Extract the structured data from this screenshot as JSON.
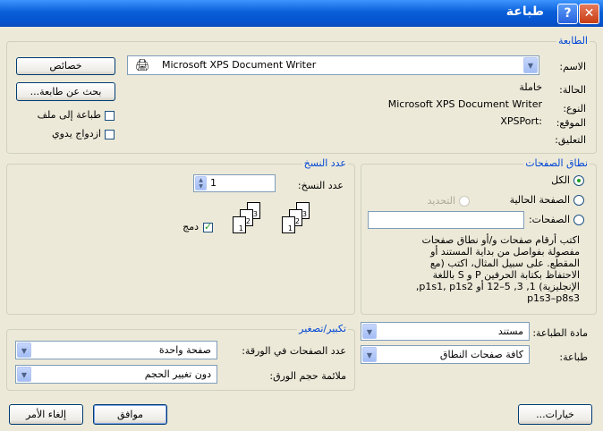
{
  "window": {
    "title": "طباعة",
    "help_icon": "question-mark",
    "close_icon": "x"
  },
  "printer": {
    "group_label": "الطابعة",
    "name_label": "الاسم:",
    "name_value": "Microsoft XPS Document Writer",
    "status_label": "الحالة:",
    "status_value": "خاملة",
    "type_label": "النوع:",
    "type_value": "Microsoft XPS Document Writer",
    "where_label": "الموقع:",
    "where_value": "XPSPort:",
    "comment_label": "التعليق:",
    "comment_value": "",
    "properties_button": "خصائص",
    "find_printer_button": "بحث عن طابعة...",
    "print_to_file_label": "طباعة إلى ملف",
    "print_to_file_checked": false,
    "manual_duplex_label": "ازدواج يدوي",
    "manual_duplex_checked": false
  },
  "page_range": {
    "group_label": "نطاق الصفحات",
    "all_label": "الكل",
    "current_page_label": "الصفحة الحالية",
    "selection_label": "التحديد",
    "pages_label": "الصفحات:",
    "pages_value": "",
    "selected": "all",
    "help_text": [
      "اكتب أرقام صفحات و/أو نطاق صفحات",
      "مفصولة بفواصل من بداية المستند أو",
      "المقطع. على سبيل المثال، اكتب (مع",
      "الاحتفاظ بكتابة الحرفين P و S باللغة",
      "الإنجليزية) 1, 3, 5–12 أو p1s1, p1s2,",
      "p1s3–p8s3"
    ]
  },
  "copies": {
    "group_label": "عدد النسخ",
    "count_label": "عدد النسخ:",
    "count_value": "1",
    "collate_label": "دمج",
    "collate_checked": true,
    "page_numbers": [
      "1",
      "2",
      "3"
    ]
  },
  "print_what": {
    "label": "مادة الطباعة:",
    "value": "مستند"
  },
  "print": {
    "label": "طباعة:",
    "value": "كافة صفحات النطاق"
  },
  "zoom": {
    "group_label": "تكبير/تصغير",
    "pages_per_sheet_label": "عدد الصفحات في الورقة:",
    "pages_per_sheet_value": "صفحة واحدة",
    "scale_label": "ملائمة حجم الورق:",
    "scale_value": "دون تغيير الحجم"
  },
  "footer": {
    "options_button": "خيارات...",
    "ok_button": "موافق",
    "cancel_button": "إلغاء الأمر"
  }
}
